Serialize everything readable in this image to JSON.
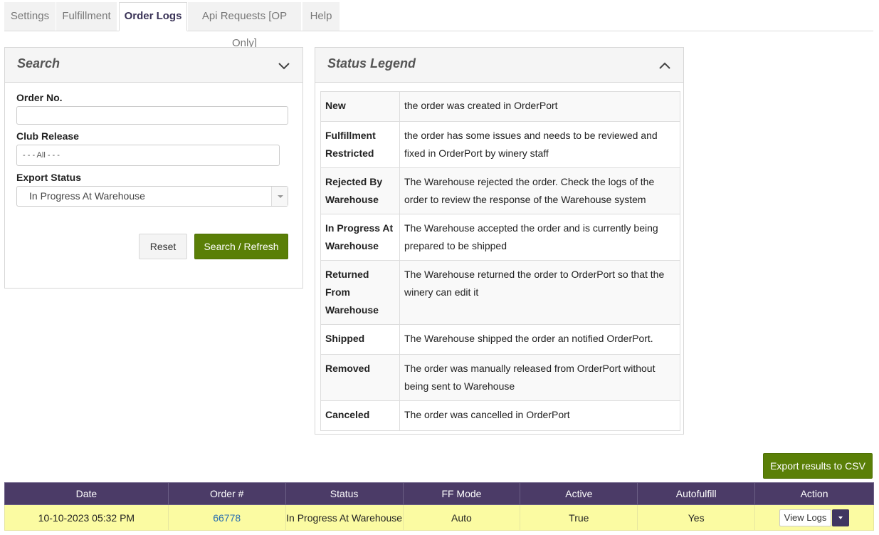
{
  "tabs": [
    {
      "label": "Settings"
    },
    {
      "label": "Fulfillment"
    },
    {
      "label": "Order Logs"
    },
    {
      "label": "Api Requests [OP Only]"
    },
    {
      "label": "Help"
    }
  ],
  "active_tab": "Order Logs",
  "search": {
    "title": "Search",
    "order_no_label": "Order No.",
    "order_no_value": "",
    "club_release_label": "Club Release",
    "club_release_placeholder": "- - - All - - -",
    "export_status_label": "Export Status",
    "export_status_value": "In Progress At Warehouse",
    "reset_label": "Reset",
    "search_label": "Search / Refresh"
  },
  "legend": {
    "title": "Status Legend",
    "rows": [
      {
        "status": "New",
        "description": "the order was created in OrderPort"
      },
      {
        "status": "Fulfillment Restricted",
        "description": "the order has some issues and needs to be reviewed and fixed in OrderPort by winery staff"
      },
      {
        "status": "Rejected By Warehouse",
        "description": "The Warehouse rejected the order. Check the logs of the order to review the response of the Warehouse system"
      },
      {
        "status": "In Progress At Warehouse",
        "description": "The Warehouse accepted the order and is currently being prepared to be shipped"
      },
      {
        "status": "Returned From Warehouse",
        "description": "The Warehouse returned the order to OrderPort so that the winery can edit it"
      },
      {
        "status": "Shipped",
        "description": "The Warehouse shipped the order an notified OrderPort."
      },
      {
        "status": "Removed",
        "description": "The order was manually released from OrderPort without being sent to Warehouse"
      },
      {
        "status": "Canceled",
        "description": "The order was cancelled in OrderPort"
      }
    ]
  },
  "export_csv_label": "Export results to CSV",
  "results": {
    "columns": [
      "Date",
      "Order #",
      "Status",
      "FF Mode",
      "Active",
      "Autofulfill",
      "Action"
    ],
    "rows": [
      {
        "date": "10-10-2023 05:32 PM",
        "order_no": "66778",
        "status": "In Progress At Warehouse",
        "ff_mode": "Auto",
        "active": "True",
        "autofulfill": "Yes",
        "action_label": "View Logs"
      }
    ]
  },
  "colors": {
    "header_purple": "#4b3b67",
    "button_green": "#5a7f07",
    "row_highlight": "#fbfba2",
    "link_blue": "#2a6fb0"
  }
}
